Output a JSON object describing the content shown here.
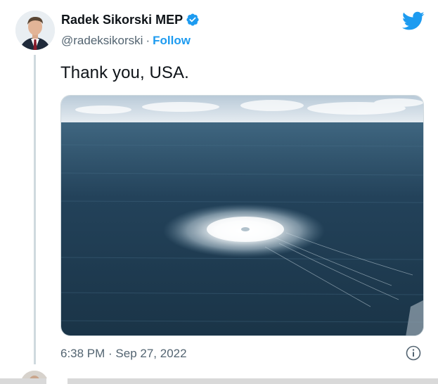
{
  "tweet": {
    "display_name": "Radek Sikorski MEP",
    "handle": "@radeksikorski",
    "separator": "·",
    "follow_label": "Follow",
    "text": "Thank you, USA.",
    "timestamp": "6:38 PM · Sep 27, 2022"
  },
  "icons": {
    "verified": "verified-badge-icon",
    "brand": "twitter-bird-icon",
    "info": "info-icon"
  },
  "colors": {
    "accent": "#1d9bf0",
    "muted_text": "#536471",
    "primary_text": "#0f1419"
  }
}
